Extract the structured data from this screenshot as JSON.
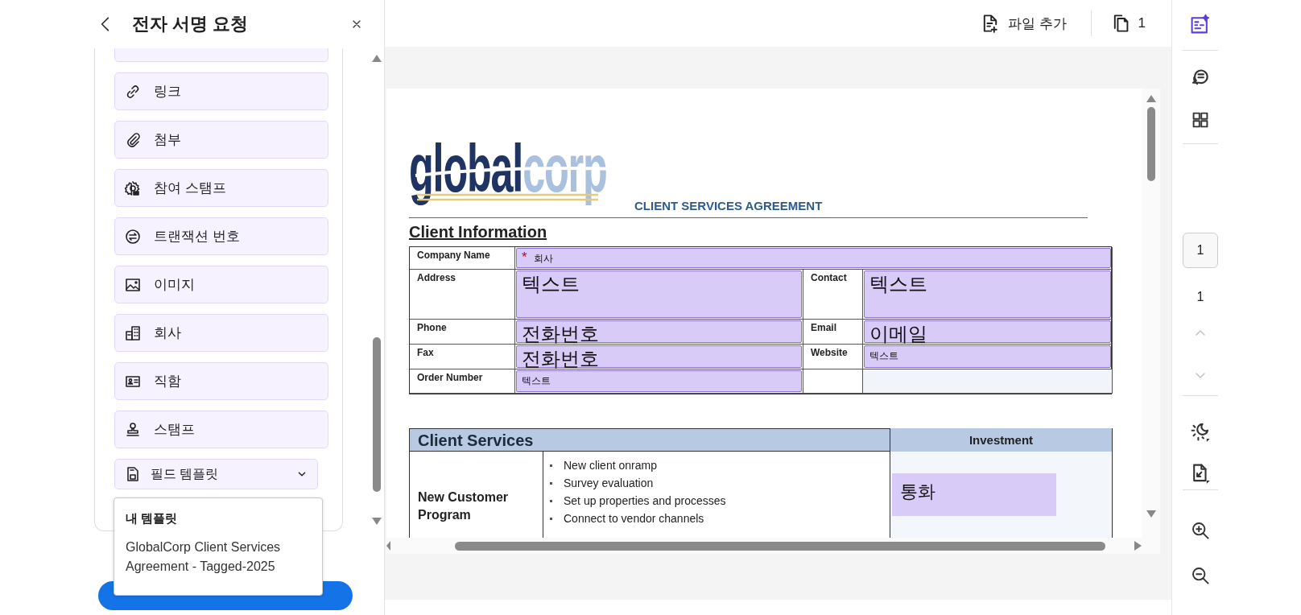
{
  "panel": {
    "title": "전자 서명 요청",
    "items": [
      {
        "label": "링크"
      },
      {
        "label": "첨부"
      },
      {
        "label": "참여 스탬프"
      },
      {
        "label": "트랜잭션 번호"
      },
      {
        "label": "이미지"
      },
      {
        "label": "회사"
      },
      {
        "label": "직함"
      },
      {
        "label": "스탬프"
      }
    ],
    "template_dropdown": {
      "label": "필드 템플릿",
      "expanded": true
    },
    "template_menu": {
      "heading": "내 템플릿",
      "items": [
        {
          "label": "GlobalCorp Client Services Agreement - Tagged-2025"
        }
      ]
    }
  },
  "top_bar": {
    "add_file": "파일 추가",
    "page_count": "1"
  },
  "document": {
    "logo": {
      "dark_part": "global",
      "light_part": "corp"
    },
    "subtitle": "CLIENT SERVICES AGREEMENT",
    "section_title": "Client Information",
    "client_info": [
      {
        "cells": [
          {
            "kind": "label",
            "text": "Company Name"
          },
          {
            "kind": "field",
            "text": "회사",
            "large_text": false,
            "required_mark": "*"
          }
        ]
      },
      {
        "cells": [
          {
            "kind": "label",
            "text": "Address"
          },
          {
            "kind": "field",
            "text": "텍스트",
            "large_text": true
          },
          {
            "kind": "label",
            "text": "Contact"
          },
          {
            "kind": "field",
            "text": "텍스트",
            "large_text": true
          }
        ]
      },
      {
        "cells": [
          {
            "kind": "label",
            "text": "Phone"
          },
          {
            "kind": "field",
            "text": "전화번호",
            "large_text": true
          },
          {
            "kind": "label",
            "text": "Email"
          },
          {
            "kind": "field",
            "text": "이메일",
            "large_text": true
          }
        ]
      },
      {
        "cells": [
          {
            "kind": "label",
            "text": "Fax"
          },
          {
            "kind": "field",
            "text": "전화번호",
            "large_text": true
          },
          {
            "kind": "label",
            "text": "Website"
          },
          {
            "kind": "field",
            "text": "텍스트",
            "large_text": false
          }
        ]
      },
      {
        "cells": [
          {
            "kind": "label",
            "text": "Order Number"
          },
          {
            "kind": "field",
            "text": "텍스트",
            "large_text": false
          },
          {
            "kind": "empty"
          },
          {
            "kind": "shaded"
          }
        ]
      }
    ],
    "services": {
      "title": "Client Services",
      "investment_header": "Investment",
      "rows": [
        {
          "program": "New Customer Program",
          "bullets": [
            "New client onramp",
            "Survey evaluation",
            "Set up properties and processes",
            "Connect to vendor channels"
          ],
          "investment_field": "통화"
        }
      ]
    }
  },
  "right_toolbar": {
    "tools": [
      {
        "selected": true
      },
      {
        "selected": false
      },
      {
        "selected": false
      }
    ],
    "page_field": "1",
    "page_total": "1",
    "previous_page": {
      "disabled": true
    },
    "next_page": {
      "disabled": true
    }
  }
}
